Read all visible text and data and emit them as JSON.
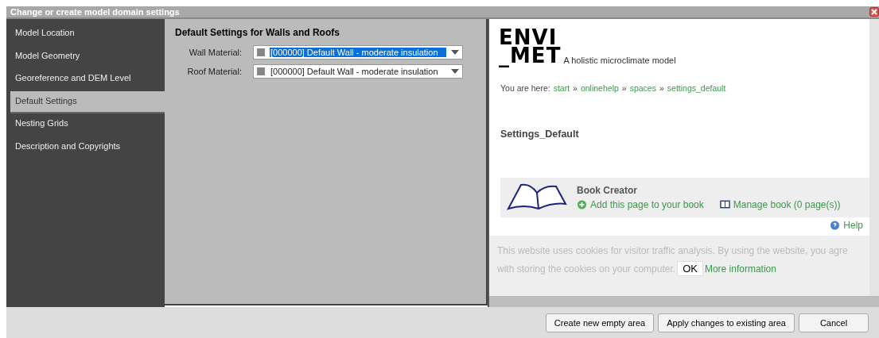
{
  "window": {
    "title": "Change or create model domain settings"
  },
  "sidebar": {
    "items": [
      {
        "label": "Model Location",
        "selected": false
      },
      {
        "label": "Model Geometry",
        "selected": false
      },
      {
        "label": "Georeference and DEM Level",
        "selected": false
      },
      {
        "label": "Default Settings",
        "selected": true
      },
      {
        "label": "Nesting Grids",
        "selected": false
      },
      {
        "label": "Description and Copyrights",
        "selected": false
      }
    ]
  },
  "form": {
    "heading": "Default Settings for Walls and Roofs",
    "fields": [
      {
        "label": "Wall Material:",
        "value": "[000000] Default Wall - moderate insulation",
        "selected": true
      },
      {
        "label": "Roof Material:",
        "value": "[000000] Default Wall - moderate insulation",
        "selected": false
      }
    ]
  },
  "help_page": {
    "logo": [
      "ENVI",
      "_MET"
    ],
    "tagline": "A holistic microclimate model",
    "breadcrumb": {
      "prefix": "You are here:",
      "links": [
        "start",
        "onlinehelp",
        "spaces",
        "settings_default"
      ],
      "separator": "»"
    },
    "heading": "Settings_Default",
    "book_creator": {
      "title": "Book Creator",
      "add": "Add this page to your book",
      "manage": "Manage book (0 page(s))"
    },
    "help": "Help",
    "cookie_notice": {
      "line1": "This website uses cookies for visitor traffic analysis. By using the website, you agre",
      "line2": "with storing the cookies on your computer.",
      "ok": "OK",
      "more": "More information"
    }
  },
  "buttons": [
    "Create new empty area",
    "Apply changes to existing area",
    "Cancel"
  ]
}
